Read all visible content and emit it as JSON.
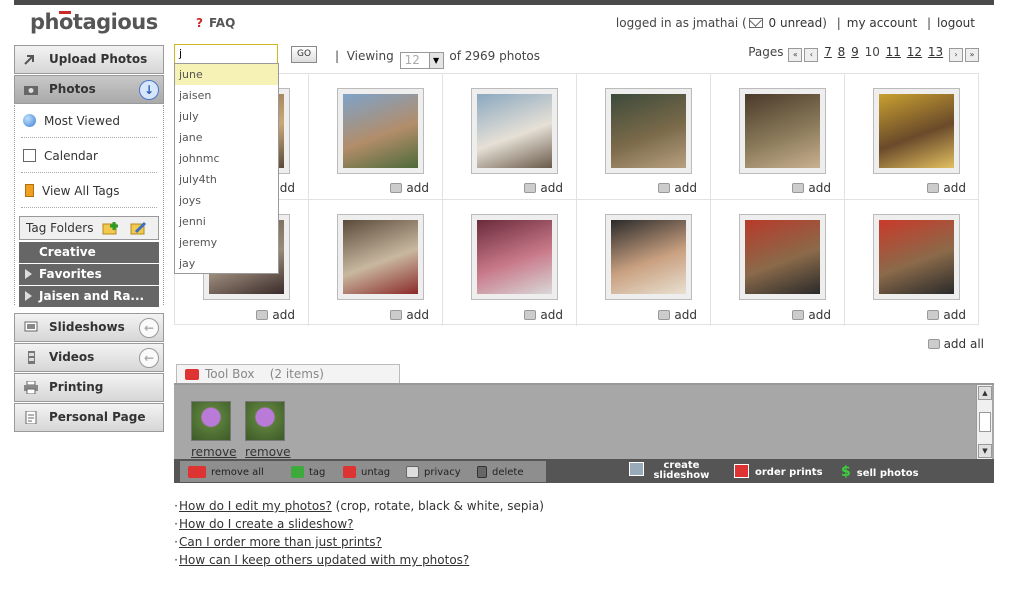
{
  "header": {
    "logo": "photagious",
    "faq_icon": "?",
    "faq": "FAQ",
    "logged_in": "logged in as jmathai",
    "unread": "0 unread",
    "my_account": "my account",
    "logout": "logout"
  },
  "sidebar": {
    "upload": "Upload Photos",
    "photos": "Photos",
    "most_viewed": "Most Viewed",
    "calendar": "Calendar",
    "view_all_tags": "View All Tags",
    "tag_folders": "Tag Folders",
    "folders": [
      "Creative",
      "Favorites",
      "Jaisen and Ra..."
    ],
    "slideshows": "Slideshows",
    "videos": "Videos",
    "printing": "Printing",
    "personal_page": "Personal Page"
  },
  "search": {
    "value": "j",
    "go": "GO",
    "suggestions": [
      "june",
      "jaisen",
      "july",
      "jane",
      "johnmc",
      "july4th",
      "joys",
      "jenni",
      "jeremy",
      "jay"
    ]
  },
  "viewing": {
    "label": "Viewing",
    "per_page": "12",
    "of_label": "of 2969 photos"
  },
  "pages": {
    "label": "Pages",
    "first": "«",
    "prev": "‹",
    "next": "›",
    "last": "»",
    "items": [
      "7",
      "8",
      "9",
      "10",
      "11",
      "12",
      "13"
    ],
    "current": "10"
  },
  "grid": {
    "add_label": "add",
    "add_all": "add all"
  },
  "toolbox": {
    "title": "Tool Box",
    "count": "(2 items)",
    "remove": "remove",
    "remove_all": "remove all",
    "tag": "tag",
    "untag": "untag",
    "privacy": "privacy",
    "delete": "delete",
    "create_slideshow_1": "create",
    "create_slideshow_2": "slideshow",
    "order_prints": "order prints",
    "sell_photos": "sell photos"
  },
  "help": {
    "bullet": "·",
    "q1": "How do I edit my photos?",
    "q1_note": "(crop, rotate, black & white, sepia)",
    "q2": "How do I create a slideshow?",
    "q3": "Can I order more than just prints?",
    "q4": "How can I keep others updated with my photos?"
  },
  "colors": {
    "accent_red": "#c92a2a",
    "search_border": "#c9b91f",
    "toolbox_gray": "#a7a7a7"
  }
}
